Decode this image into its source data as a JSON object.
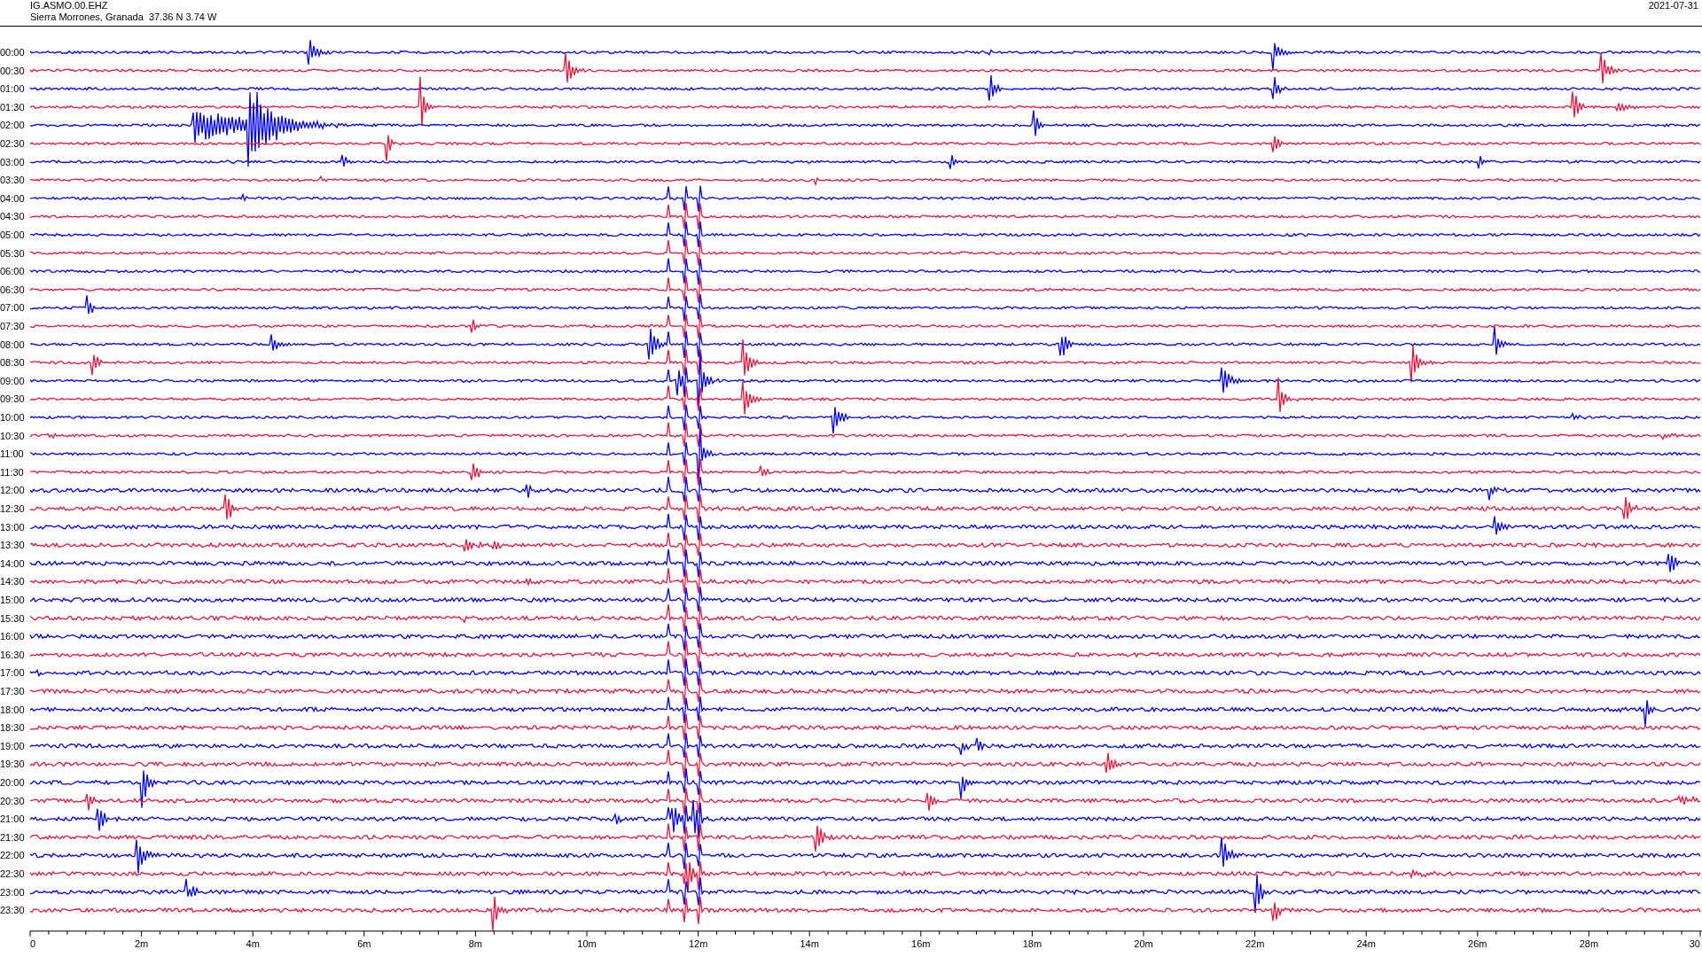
{
  "header": {
    "station": "IG.ASMO.00.EHZ",
    "location": "Sierra Morrones, Granada  37.36 N 3.74 W",
    "date": "2021-07-31"
  },
  "rows": [
    {
      "label": "00:00",
      "color": "#0000ff"
    },
    {
      "label": "00:30",
      "color": "#f0143c"
    },
    {
      "label": "01:00",
      "color": "#0000ff"
    },
    {
      "label": "01:30",
      "color": "#f0143c"
    },
    {
      "label": "02:00",
      "color": "#0000ff"
    },
    {
      "label": "02:30",
      "color": "#f0143c"
    },
    {
      "label": "03:00",
      "color": "#0000ff"
    },
    {
      "label": "03:30",
      "color": "#f0143c"
    },
    {
      "label": "04:00",
      "color": "#0000ff"
    },
    {
      "label": "04:30",
      "color": "#f0143c"
    },
    {
      "label": "05:00",
      "color": "#0000ff"
    },
    {
      "label": "05:30",
      "color": "#f0143c"
    },
    {
      "label": "06:00",
      "color": "#0000ff"
    },
    {
      "label": "06:30",
      "color": "#f0143c"
    },
    {
      "label": "07:00",
      "color": "#0000ff"
    },
    {
      "label": "07:30",
      "color": "#f0143c"
    },
    {
      "label": "08:00",
      "color": "#0000ff"
    },
    {
      "label": "08:30",
      "color": "#f0143c"
    },
    {
      "label": "09:00",
      "color": "#0000ff"
    },
    {
      "label": "09:30",
      "color": "#f0143c"
    },
    {
      "label": "10:00",
      "color": "#0000ff"
    },
    {
      "label": "10:30",
      "color": "#f0143c"
    },
    {
      "label": "11:00",
      "color": "#0000ff"
    },
    {
      "label": "11:30",
      "color": "#f0143c"
    },
    {
      "label": "12:00",
      "color": "#0000ff"
    },
    {
      "label": "12:30",
      "color": "#f0143c"
    },
    {
      "label": "13:00",
      "color": "#0000ff"
    },
    {
      "label": "13:30",
      "color": "#f0143c"
    },
    {
      "label": "14:00",
      "color": "#0000ff"
    },
    {
      "label": "14:30",
      "color": "#f0143c"
    },
    {
      "label": "15:00",
      "color": "#0000ff"
    },
    {
      "label": "15:30",
      "color": "#f0143c"
    },
    {
      "label": "16:00",
      "color": "#0000ff"
    },
    {
      "label": "16:30",
      "color": "#f0143c"
    },
    {
      "label": "17:00",
      "color": "#0000ff"
    },
    {
      "label": "17:30",
      "color": "#f0143c"
    },
    {
      "label": "18:00",
      "color": "#0000ff"
    },
    {
      "label": "18:30",
      "color": "#f0143c"
    },
    {
      "label": "19:00",
      "color": "#0000ff"
    },
    {
      "label": "19:30",
      "color": "#f0143c"
    },
    {
      "label": "20:00",
      "color": "#0000ff"
    },
    {
      "label": "20:30",
      "color": "#f0143c"
    },
    {
      "label": "21:00",
      "color": "#0000ff"
    },
    {
      "label": "21:30",
      "color": "#f0143c"
    },
    {
      "label": "22:00",
      "color": "#0000ff"
    },
    {
      "label": "22:30",
      "color": "#f0143c"
    },
    {
      "label": "23:00",
      "color": "#0000ff"
    },
    {
      "label": "23:30",
      "color": "#f0143c"
    }
  ],
  "x_axis": {
    "ticks": [
      "0",
      "2m",
      "4m",
      "6m",
      "8m",
      "10m",
      "12m",
      "14m",
      "16m",
      "18m",
      "20m",
      "22m",
      "24m",
      "26m",
      "28m",
      "30"
    ]
  }
}
